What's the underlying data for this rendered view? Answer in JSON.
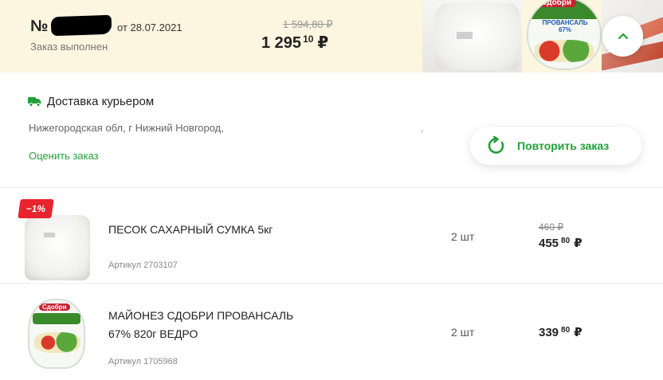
{
  "order": {
    "number_prefix": "№",
    "date_text": "от 28.07.2021",
    "status": "Заказ выполнен",
    "old_total": "1 594,80 ₽",
    "total": {
      "rub": "1 295",
      "kop": "10",
      "currency": "₽"
    }
  },
  "delivery": {
    "type": "Доставка курьером",
    "address": "Нижегородская обл, г Нижний Новгород,",
    "address_tail": ",",
    "rate_link": "Оценить заказ",
    "repeat_button": "Повторить заказ"
  },
  "header_images": {
    "mayo_brand": "Сдобри",
    "mayo_name": "ПРОВАНСАЛЬ",
    "mayo_fat": "67%"
  },
  "items": [
    {
      "discount_badge": "−1%",
      "name_line1": "ПЕСОК САХАРНЫЙ СУМКА 5кг",
      "name_line2": "",
      "sku": "Артикул 2703107",
      "qty": "2 шт",
      "old_price": "460 ₽",
      "price": {
        "rub": "455",
        "kop": "80",
        "currency": "₽"
      }
    },
    {
      "brand": "Сдобри",
      "name_line1": "МАЙОНЕЗ СДОБРИ ПРОВАНСАЛЬ",
      "name_line2": "67% 820г ВЕДРО",
      "sku": "Артикул 1705968",
      "qty": "2 шт",
      "price": {
        "rub": "339",
        "kop": "80",
        "currency": "₽"
      }
    }
  ],
  "colors": {
    "accent_green": "#21a038",
    "header_bg": "#fcf5df",
    "discount_red": "#e8242f"
  },
  "icons": {
    "collapse": "chevron-up-icon",
    "delivery": "truck-icon",
    "repeat": "refresh-icon"
  }
}
